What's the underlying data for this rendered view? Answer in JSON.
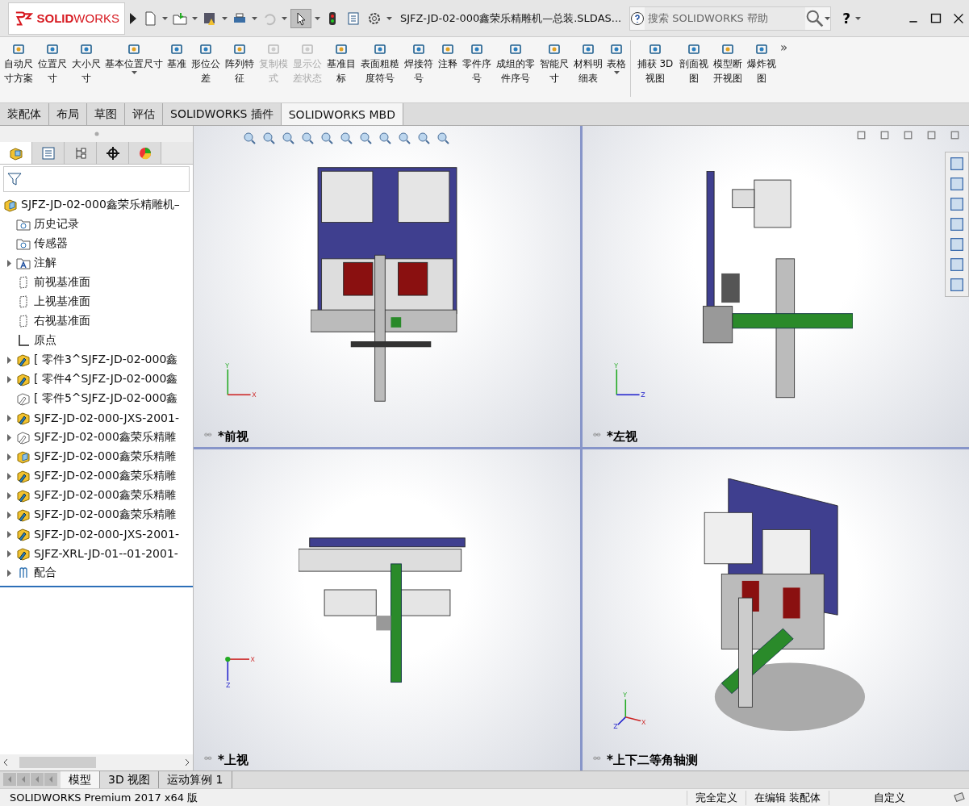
{
  "window": {
    "logo": "**SOLID**WORKS",
    "title": "SJFZ-JD-02-000鑫荣乐精雕机—总装.SLDAS...",
    "help": "?"
  },
  "search": {
    "placeholder": "搜索 SOLIDWORKS 帮助"
  },
  "commands": [
    {
      "label": "自动尺寸方案",
      "disabled": false,
      "dropdown": false
    },
    {
      "label": "位置尺寸",
      "disabled": false,
      "dropdown": false
    },
    {
      "label": "大小尺寸",
      "disabled": false,
      "dropdown": false
    },
    {
      "label": "基本位置尺寸",
      "disabled": false,
      "dropdown": true
    },
    {
      "label": "基准",
      "disabled": false,
      "dropdown": false
    },
    {
      "label": "形位公差",
      "disabled": false,
      "dropdown": false
    },
    {
      "label": "阵列特征",
      "disabled": false,
      "dropdown": false
    },
    {
      "label": "复制模式",
      "disabled": true,
      "dropdown": false
    },
    {
      "label": "显示公差状态",
      "disabled": true,
      "dropdown": false
    },
    {
      "label": "基准目标",
      "disabled": false,
      "dropdown": false
    },
    {
      "label": "表面粗糙度符号",
      "disabled": false,
      "dropdown": false
    },
    {
      "label": "焊接符号",
      "disabled": false,
      "dropdown": false
    },
    {
      "label": "注释",
      "disabled": false,
      "dropdown": false
    },
    {
      "label": "零件序号",
      "disabled": false,
      "dropdown": false
    },
    {
      "label": "成组的零件序号",
      "disabled": false,
      "dropdown": false
    },
    {
      "label": "智能尺寸",
      "disabled": false,
      "dropdown": false
    },
    {
      "label": "材料明细表",
      "disabled": false,
      "dropdown": false
    },
    {
      "label": "表格",
      "disabled": false,
      "dropdown": true
    }
  ],
  "commands_2": [
    {
      "label": "捕获 3D视图",
      "disabled": false,
      "dropdown": false
    },
    {
      "label": "剖面视图",
      "disabled": false,
      "dropdown": false
    },
    {
      "label": "模型断开视图",
      "disabled": false,
      "dropdown": false
    },
    {
      "label": "爆炸视图",
      "disabled": false,
      "dropdown": false
    }
  ],
  "more": "»",
  "tabs": [
    {
      "label": "装配体",
      "selected": false
    },
    {
      "label": "布局",
      "selected": false
    },
    {
      "label": "草图",
      "selected": false
    },
    {
      "label": "评估",
      "selected": false
    },
    {
      "label": "SOLIDWORKS 插件",
      "selected": false
    },
    {
      "label": "SOLIDWORKS MBD",
      "selected": true
    }
  ],
  "panel_tabs": [
    {
      "kind": "feature",
      "selected": true
    },
    {
      "kind": "property",
      "selected": false
    },
    {
      "kind": "config",
      "selected": false
    },
    {
      "kind": "dimxpert",
      "selected": false
    },
    {
      "kind": "display",
      "selected": false
    }
  ],
  "tree": {
    "label": "SJFZ-JD-02-000鑫荣乐精雕机–",
    "children": [
      {
        "label": "历史记录",
        "kind": "history",
        "expandable": false
      },
      {
        "label": "传感器",
        "kind": "sensor",
        "expandable": false
      },
      {
        "label": "注解",
        "kind": "annotation",
        "expandable": true
      },
      {
        "label": "前视基准面",
        "kind": "plane",
        "expandable": false
      },
      {
        "label": "上视基准面",
        "kind": "plane",
        "expandable": false
      },
      {
        "label": "右视基准面",
        "kind": "plane",
        "expandable": false
      },
      {
        "label": "原点",
        "kind": "origin",
        "expandable": false
      },
      {
        "label": "[ 零件3^SJFZ-JD-02-000鑫",
        "kind": "part",
        "expandable": true,
        "suppressed": false
      },
      {
        "label": "[ 零件4^SJFZ-JD-02-000鑫",
        "kind": "part",
        "expandable": true,
        "suppressed": false
      },
      {
        "label": "[ 零件5^SJFZ-JD-02-000鑫",
        "kind": "part",
        "expandable": false,
        "suppressed": true
      },
      {
        "label": "SJFZ-JD-02-000-JXS-2001-",
        "kind": "part",
        "expandable": true,
        "suppressed": false
      },
      {
        "label": "SJFZ-JD-02-000鑫荣乐精雕",
        "kind": "part",
        "expandable": true,
        "suppressed": true
      },
      {
        "label": "SJFZ-JD-02-000鑫荣乐精雕",
        "kind": "assembly",
        "expandable": true,
        "suppressed": false
      },
      {
        "label": "SJFZ-JD-02-000鑫荣乐精雕",
        "kind": "part",
        "expandable": true,
        "suppressed": false
      },
      {
        "label": "SJFZ-JD-02-000鑫荣乐精雕",
        "kind": "part",
        "expandable": true,
        "suppressed": false
      },
      {
        "label": "SJFZ-JD-02-000鑫荣乐精雕",
        "kind": "part",
        "expandable": true,
        "suppressed": false
      },
      {
        "label": "SJFZ-JD-02-000-JXS-2001-",
        "kind": "part",
        "expandable": true,
        "suppressed": false
      },
      {
        "label": "SJFZ-XRL-JD-01--01-2001-",
        "kind": "part",
        "expandable": true,
        "suppressed": false
      },
      {
        "label": "配合",
        "kind": "mate",
        "expandable": true
      }
    ]
  },
  "viewports": [
    {
      "label": "*前视",
      "kind": "front",
      "axes": [
        "Y",
        "X"
      ]
    },
    {
      "label": "*左视",
      "kind": "left",
      "axes": [
        "Y",
        "Z"
      ]
    },
    {
      "label": "*上视",
      "kind": "top",
      "axes": [
        "X",
        "Z"
      ]
    },
    {
      "label": "*上下二等角轴测",
      "kind": "iso",
      "axes": [
        "Y",
        "X",
        "Z"
      ]
    }
  ],
  "bottom_tabs": [
    {
      "label": "模型",
      "selected": true
    },
    {
      "label": "3D 视图",
      "selected": false
    },
    {
      "label": "运动算例 1",
      "selected": false
    }
  ],
  "status_bar": [
    "SOLIDWORKS Premium 2017 x64 版",
    "完全定义",
    "在编辑 装配体",
    "自定义"
  ]
}
